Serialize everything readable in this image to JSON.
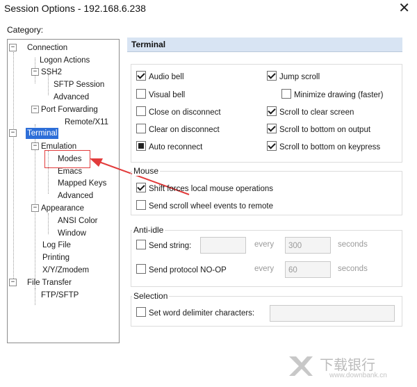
{
  "window": {
    "title": "Session Options - 192.168.6.238",
    "close_symbol": "✕"
  },
  "sidebar": {
    "category_label": "Category:",
    "items": [
      {
        "label": "Connection",
        "expander": "−"
      },
      {
        "label": "Logon Actions"
      },
      {
        "label": "SSH2",
        "expander": "−"
      },
      {
        "label": "SFTP Session"
      },
      {
        "label": "Advanced"
      },
      {
        "label": "Port Forwarding",
        "expander": "−"
      },
      {
        "label": "Remote/X11"
      },
      {
        "label": "Terminal",
        "expander": "−",
        "selected": true
      },
      {
        "label": "Emulation",
        "expander": "−"
      },
      {
        "label": "Modes",
        "highlighted": true
      },
      {
        "label": "Emacs"
      },
      {
        "label": "Mapped Keys"
      },
      {
        "label": "Advanced"
      },
      {
        "label": "Appearance",
        "expander": "−"
      },
      {
        "label": "ANSI Color"
      },
      {
        "label": "Window"
      },
      {
        "label": "Log File"
      },
      {
        "label": "Printing"
      },
      {
        "label": "X/Y/Zmodem"
      },
      {
        "label": "File Transfer",
        "expander": "−"
      },
      {
        "label": "FTP/SFTP"
      }
    ]
  },
  "panel": {
    "header": "Terminal",
    "options": [
      {
        "label": "Audio bell",
        "checked": true
      },
      {
        "label": "Jump scroll",
        "checked": true
      },
      {
        "label": "Visual bell",
        "checked": false
      },
      {
        "label": "Minimize drawing (faster)",
        "checked": false
      },
      {
        "label": "Close on disconnect",
        "checked": false
      },
      {
        "label": "Scroll to clear screen",
        "checked": true
      },
      {
        "label": "Clear on disconnect",
        "checked": false
      },
      {
        "label": "Scroll to bottom on output",
        "checked": true
      },
      {
        "label": "Auto reconnect",
        "checked": "partial"
      },
      {
        "label": "Scroll to bottom on keypress",
        "checked": true
      }
    ],
    "mouse": {
      "title": "Mouse",
      "options": [
        {
          "label": "Shift forces local mouse operations",
          "checked": true
        },
        {
          "label": "Send scroll wheel events to remote",
          "checked": false
        }
      ]
    },
    "anti_idle": {
      "title": "Anti-idle",
      "send_string": {
        "label": "Send string:",
        "every": "every",
        "value": "300",
        "unit": "seconds"
      },
      "send_noop": {
        "label": "Send protocol NO-OP",
        "every": "every",
        "value": "60",
        "unit": "seconds"
      }
    },
    "selection": {
      "title": "Selection",
      "delimiter_label": "Set word delimiter characters:"
    }
  },
  "watermark": {
    "brand": "下载银行",
    "url": "www.downbank.cn"
  },
  "colors": {
    "selected": "#2d6ed8",
    "header_bg": "#d8e4f3",
    "annotation": "#e23b3b"
  }
}
